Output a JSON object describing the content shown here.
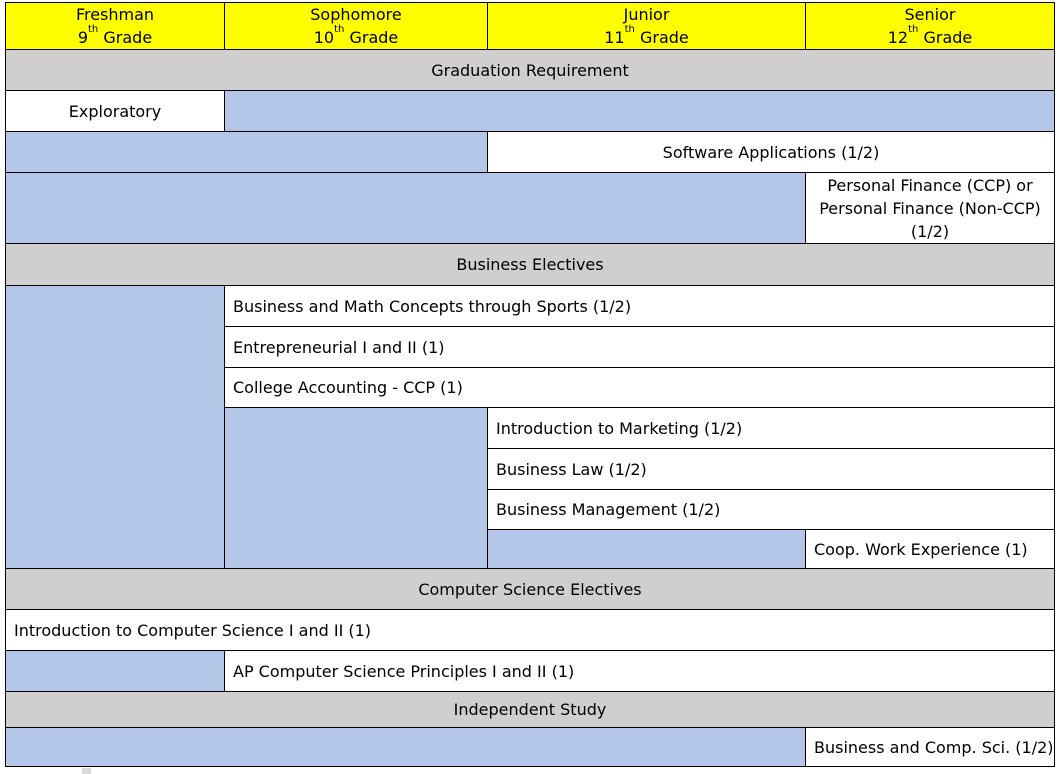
{
  "grades": [
    {
      "name": "Freshman",
      "num": "9",
      "suffix": "th",
      "label": "Grade"
    },
    {
      "name": "Sophomore",
      "num": "10",
      "suffix": "th",
      "label": "Grade"
    },
    {
      "name": "Junior",
      "num": "11",
      "suffix": "th",
      "label": "Grade"
    },
    {
      "name": "Senior",
      "num": "12",
      "suffix": "th",
      "label": "Grade"
    }
  ],
  "sections": {
    "graduation": "Graduation Requirement",
    "business": "Business Electives",
    "computer_science": "Computer Science Electives",
    "independent": "Independent Study"
  },
  "courses": {
    "exploratory": "Exploratory",
    "software_applications": "Software Applications (1/2)",
    "personal_finance": [
      "Personal Finance (CCP) or",
      "Personal Finance (Non-CCP)",
      "(1/2)"
    ],
    "business_math_sports": "Business and Math Concepts through Sports (1/2)",
    "entrepreneurial": "Entrepreneurial I and II (1)",
    "college_accounting": "College Accounting - CCP (1)",
    "intro_marketing": "Introduction to Marketing (1/2)",
    "business_law": "Business Law (1/2)",
    "business_management": "Business Management (1/2)",
    "coop_work": "Coop. Work Experience (1)",
    "intro_cs": "Introduction to Computer Science I and II (1)",
    "ap_csp": "AP Computer Science Principles I and II (1)",
    "business_comp_sci": "Business and Comp. Sci. (1/2)"
  },
  "colors": {
    "header": "#ffff00",
    "section": "#d0cece",
    "not_offered": "#b4c6e7",
    "offered": "#ffffff"
  }
}
